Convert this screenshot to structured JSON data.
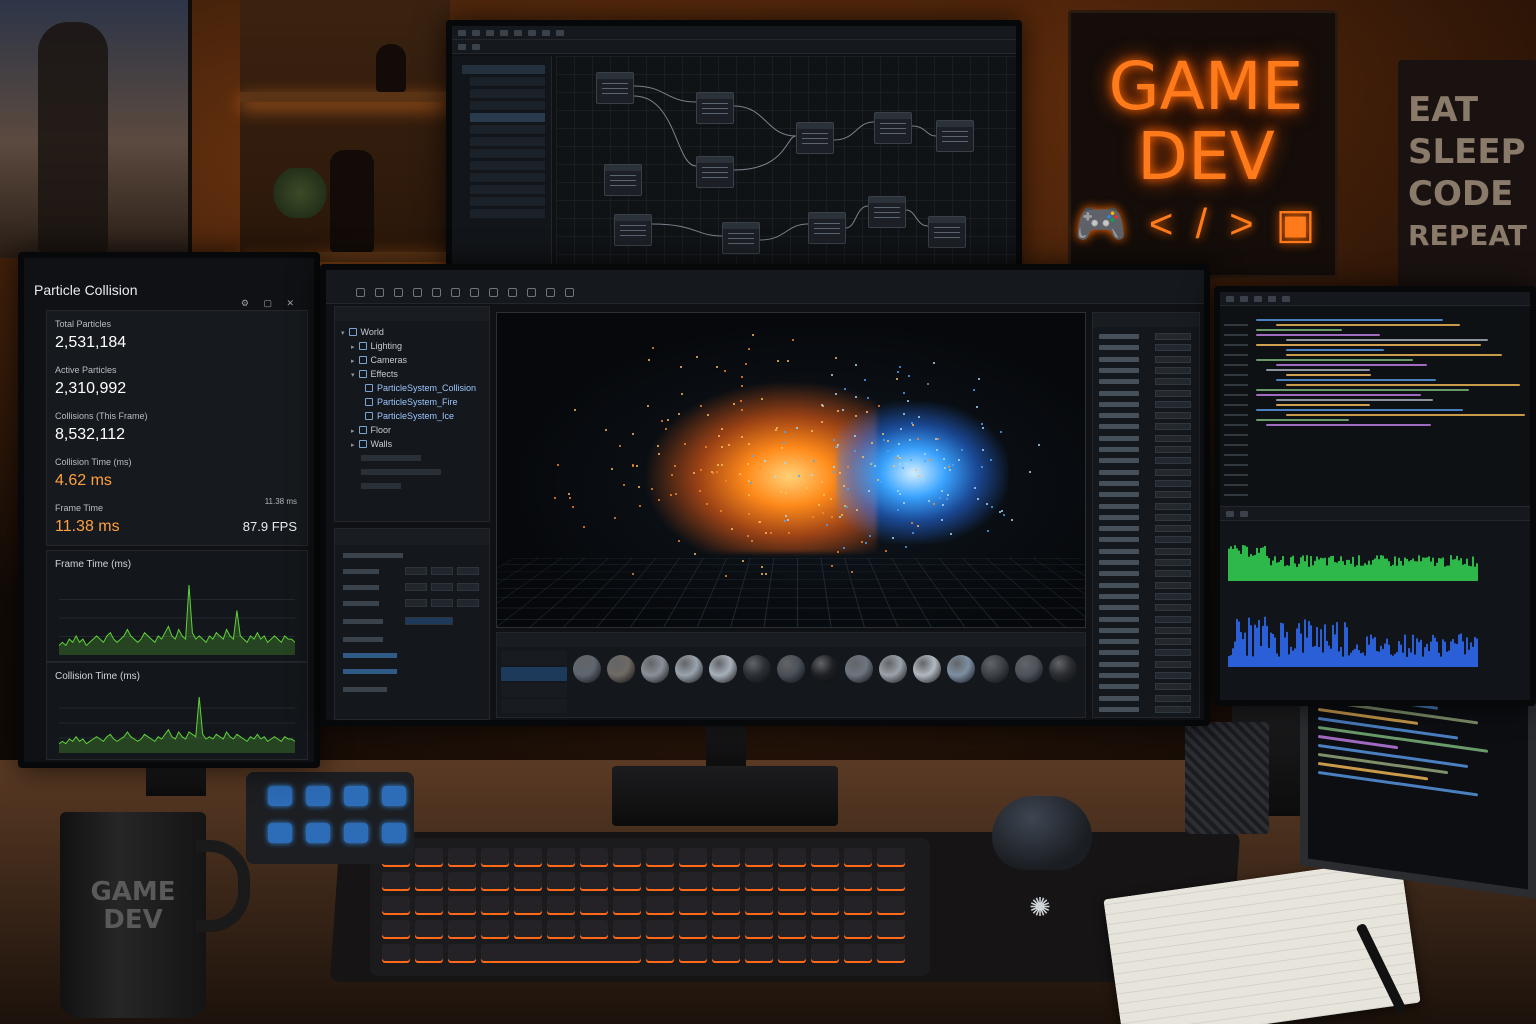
{
  "room": {
    "sign": {
      "line1": "GAME",
      "line2": "DEV",
      "glyphs": "🎮</>▣"
    },
    "sign2": {
      "words": [
        "EAT",
        "SLEEP",
        "CODE",
        "REPEAT"
      ]
    },
    "mug": {
      "line1": "GAME",
      "line2": "DEV"
    }
  },
  "stats_monitor": {
    "title": "Particle Collision",
    "stats": [
      {
        "label": "Total Particles",
        "value": "2,531,184",
        "color": "#ffffff"
      },
      {
        "label": "Active Particles",
        "value": "2,310,992",
        "color": "#ffffff"
      },
      {
        "label": "Collisions (This Frame)",
        "value": "8,532,112",
        "color": "#ffffff"
      },
      {
        "label": "Collision Time (ms)",
        "value": "4.62 ms",
        "color": "#ffa040"
      },
      {
        "label": "Frame Time",
        "value": "11.38 ms",
        "color": "#ffa040"
      }
    ],
    "frame_time_side": "11.38 ms",
    "fps": "87.9 FPS",
    "charts": [
      {
        "title": "Frame Time (ms)",
        "color": "#5fd13a",
        "values": [
          3,
          4,
          3,
          5,
          4,
          6,
          4,
          5,
          3,
          4,
          5,
          6,
          5,
          4,
          6,
          7,
          5,
          4,
          5,
          6,
          8,
          6,
          5,
          4,
          5,
          7,
          6,
          5,
          4,
          6,
          5,
          7,
          9,
          6,
          5,
          8,
          6,
          5,
          22,
          7,
          5,
          6,
          5,
          4,
          6,
          5,
          7,
          6,
          5,
          8,
          6,
          5,
          14,
          6,
          5,
          4,
          6,
          5,
          7,
          5,
          6,
          4,
          5,
          6,
          5,
          4,
          6,
          5,
          5,
          4
        ]
      },
      {
        "title": "Collision Time (ms)",
        "color": "#5fd13a",
        "values": [
          4,
          5,
          4,
          6,
          5,
          7,
          5,
          6,
          4,
          5,
          6,
          7,
          6,
          5,
          7,
          8,
          6,
          5,
          6,
          7,
          9,
          7,
          6,
          5,
          6,
          8,
          7,
          6,
          5,
          7,
          6,
          8,
          10,
          7,
          6,
          9,
          7,
          6,
          9,
          8,
          7,
          24,
          8,
          6,
          7,
          6,
          8,
          7,
          6,
          9,
          7,
          6,
          8,
          7,
          6,
          5,
          7,
          6,
          8,
          6,
          7,
          5,
          6,
          7,
          6,
          5,
          7,
          6,
          6,
          5
        ]
      }
    ]
  },
  "main_editor": {
    "hierarchy": [
      {
        "label": "World",
        "caret": "▾",
        "indent": 0
      },
      {
        "label": "Lighting",
        "caret": "▸",
        "indent": 1
      },
      {
        "label": "Cameras",
        "caret": "▸",
        "indent": 1
      },
      {
        "label": "Effects",
        "caret": "▾",
        "indent": 1
      },
      {
        "label": "ParticleSystem_Collision",
        "caret": "",
        "indent": 2
      },
      {
        "label": "ParticleSystem_Fire",
        "caret": "",
        "indent": 2
      },
      {
        "label": "ParticleSystem_Ice",
        "caret": "",
        "indent": 2
      },
      {
        "label": "Floor",
        "caret": "▸",
        "indent": 1
      },
      {
        "label": "Walls",
        "caret": "▸",
        "indent": 1
      }
    ],
    "materials": [
      "#5f6670",
      "#6f6a64",
      "#8a9099",
      "#9aa3ad",
      "#a7b0ba",
      "#2c3036",
      "#4a5058",
      "#1e2024",
      "#6e7580",
      "#9ba2aa",
      "#b2b9c1",
      "#7d8fa3",
      "#3c4148",
      "#4d535b",
      "#2a2d32"
    ]
  }
}
